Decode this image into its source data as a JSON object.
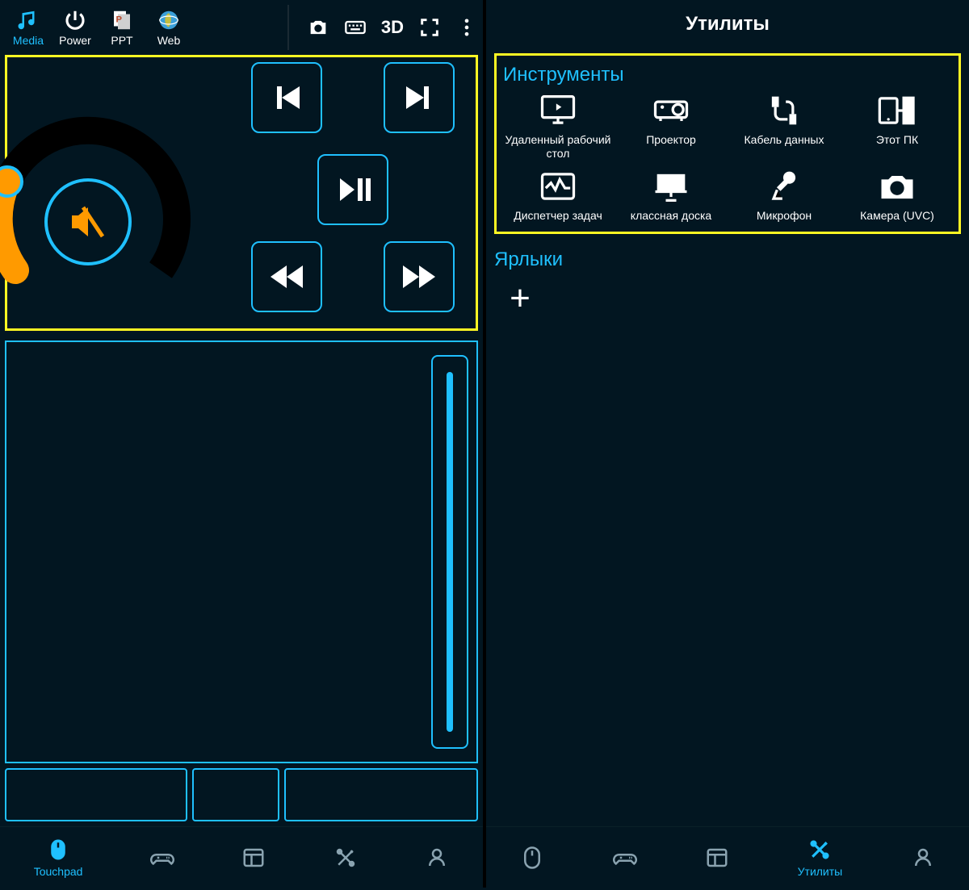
{
  "left": {
    "tabs": {
      "media": "Media",
      "power": "Power",
      "ppt": "PPT",
      "web": "Web"
    },
    "actions": {
      "threeD": "3D"
    },
    "bottomNav": {
      "touchpad": "Touchpad"
    }
  },
  "right": {
    "title": "Утилиты",
    "tools": {
      "heading": "Инструменты",
      "remoteDesktop": "Удаленный рабочий стол",
      "projector": "Проектор",
      "dataCable": "Кабель данных",
      "thisPc": "Этот ПК",
      "taskManager": "Диспетчер задач",
      "whiteboard": "классная доска",
      "microphone": "Микрофон",
      "camera": "Камера (UVC)"
    },
    "shortcuts": {
      "heading": "Ярлыки"
    },
    "bottomNav": {
      "utilities": "Утилиты"
    }
  }
}
